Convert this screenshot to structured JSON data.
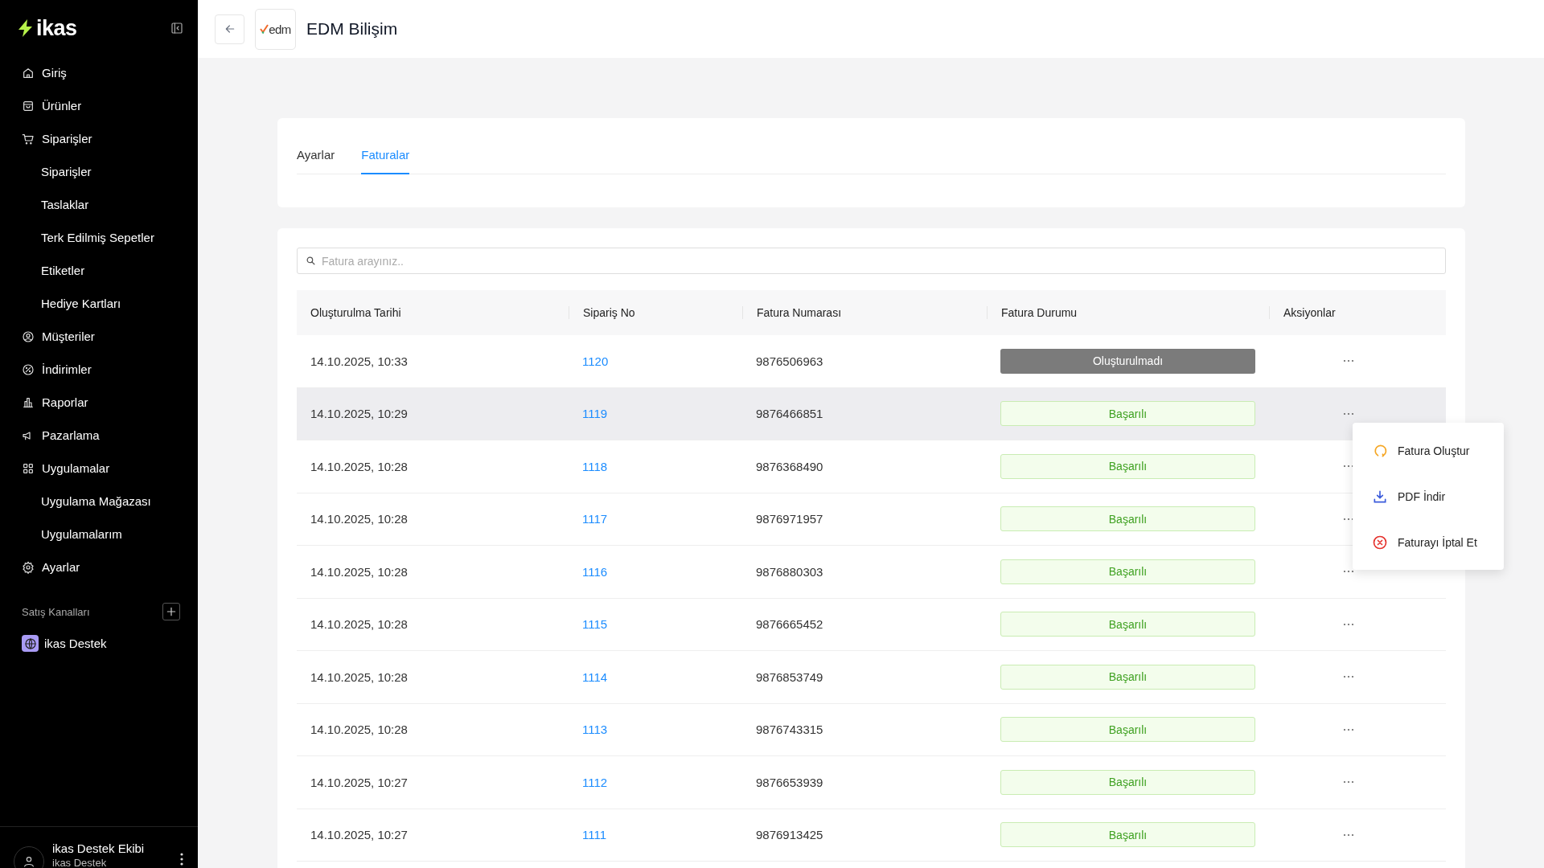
{
  "sidebar": {
    "logo": "ikas",
    "items": [
      {
        "label": "Giriş"
      },
      {
        "label": "Ürünler"
      },
      {
        "label": "Siparişler",
        "children": [
          {
            "label": "Siparişler"
          },
          {
            "label": "Taslaklar"
          },
          {
            "label": "Terk Edilmiş Sepetler"
          },
          {
            "label": "Etiketler"
          },
          {
            "label": "Hediye Kartları"
          }
        ]
      },
      {
        "label": "Müşteriler"
      },
      {
        "label": "İndirimler"
      },
      {
        "label": "Raporlar"
      },
      {
        "label": "Pazarlama"
      },
      {
        "label": "Uygulamalar",
        "children": [
          {
            "label": "Uygulama Mağazası"
          },
          {
            "label": "Uygulamalarım"
          }
        ]
      },
      {
        "label": "Ayarlar"
      }
    ],
    "channels_title": "Satış Kanalları",
    "channels": [
      {
        "label": "ikas Destek"
      }
    ],
    "user": {
      "name": "ikas Destek Ekibi",
      "store": "ikas Destek"
    }
  },
  "header": {
    "logo_text": "edm",
    "title": "EDM Bilişim"
  },
  "tabs": [
    {
      "label": "Ayarlar",
      "selected": false
    },
    {
      "label": "Faturalar",
      "selected": true
    }
  ],
  "search": {
    "placeholder": "Fatura arayınız.."
  },
  "table": {
    "columns": [
      "Oluşturulma Tarihi",
      "Sipariş No",
      "Fatura Numarası",
      "Fatura Durumu",
      "Aksiyonlar"
    ],
    "rows": [
      {
        "date": "14.10.2025, 10:33",
        "order": "1120",
        "invoice": "9876506963",
        "status": "Oluşturulmadı",
        "kind": "pending",
        "selected": false
      },
      {
        "date": "14.10.2025, 10:29",
        "order": "1119",
        "invoice": "9876466851",
        "status": "Başarılı",
        "kind": "success",
        "selected": true
      },
      {
        "date": "14.10.2025, 10:28",
        "order": "1118",
        "invoice": "9876368490",
        "status": "Başarılı",
        "kind": "success",
        "selected": false
      },
      {
        "date": "14.10.2025, 10:28",
        "order": "1117",
        "invoice": "9876971957",
        "status": "Başarılı",
        "kind": "success",
        "selected": false
      },
      {
        "date": "14.10.2025, 10:28",
        "order": "1116",
        "invoice": "9876880303",
        "status": "Başarılı",
        "kind": "success",
        "selected": false
      },
      {
        "date": "14.10.2025, 10:28",
        "order": "1115",
        "invoice": "9876665452",
        "status": "Başarılı",
        "kind": "success",
        "selected": false
      },
      {
        "date": "14.10.2025, 10:28",
        "order": "1114",
        "invoice": "9876853749",
        "status": "Başarılı",
        "kind": "success",
        "selected": false
      },
      {
        "date": "14.10.2025, 10:28",
        "order": "1113",
        "invoice": "9876743315",
        "status": "Başarılı",
        "kind": "success",
        "selected": false
      },
      {
        "date": "14.10.2025, 10:27",
        "order": "1112",
        "invoice": "9876653939",
        "status": "Başarılı",
        "kind": "success",
        "selected": false
      },
      {
        "date": "14.10.2025, 10:27",
        "order": "1111",
        "invoice": "9876913425",
        "status": "Başarılı",
        "kind": "success",
        "selected": false
      }
    ]
  },
  "context_menu": {
    "items": [
      {
        "label": "Fatura Oluştur",
        "kind": "create"
      },
      {
        "label": "PDF İndir",
        "kind": "download"
      },
      {
        "label": "Faturayı İptal Et",
        "kind": "cancel"
      }
    ]
  }
}
